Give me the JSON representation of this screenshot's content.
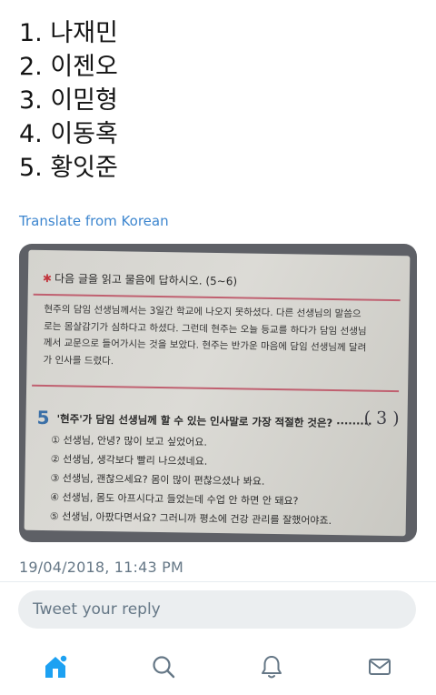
{
  "tweet": {
    "lines": [
      "1. 나재민",
      "2. 이젠오",
      "3. 이믿형",
      "4. 이동혹",
      "5. 황잇준"
    ],
    "translate_label": "Translate from Korean",
    "timestamp": "19/04/2018, 11:43 PM"
  },
  "photo": {
    "header": "다음 글을 읽고 물음에 답하시오. (5~6)",
    "passage": [
      "현주의 담임 선생님께서는 3일간 학교에 나오지 못하셨다. 다른 선생님의 말씀으",
      "로는 몸살감기가 심하다고 하셨다. 그런데 현주는 오늘 등교를 하다가 담임 선생님",
      "께서 교문으로 들어가시는 것을 보았다. 현주는 반가운 마음에 담임 선생님께 달려",
      "가 인사를 드렸다."
    ],
    "question_number": "5",
    "question": "'현주'가 담임 선생님께 할 수 있는 인사말로 가장 적절한 것은? ·········",
    "answer": "( 3 )",
    "options": [
      "① 선생님, 안녕? 많이 보고 싶었어요.",
      "② 선생님, 생각보다 빨리 나으셨네요.",
      "③ 선생님, 괜찮으세요? 몸이 많이 편찮으셨나 봐요.",
      "④ 선생님, 몸도 아프시다고 들었는데 수업 안 하면 안 돼요?",
      "⑤ 선생님, 아팠다면서요? 그러니까 평소에 건강 관리를 잘했어야죠."
    ]
  },
  "reply": {
    "placeholder": "Tweet your reply"
  },
  "nav": {
    "items": [
      {
        "icon": "home-icon",
        "active": true
      },
      {
        "icon": "search-icon",
        "active": false
      },
      {
        "icon": "notifications-bell-icon",
        "active": false
      },
      {
        "icon": "messages-envelope-icon",
        "active": false
      }
    ]
  },
  "colors": {
    "accent": "#1da1f2",
    "link": "#3d86cf",
    "muted": "#657786",
    "icon_gray": "#657786"
  }
}
